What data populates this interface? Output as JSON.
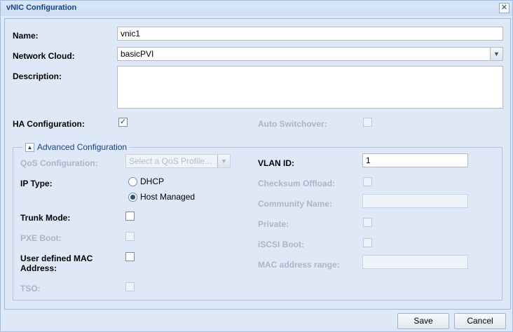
{
  "window": {
    "title": "vNIC Configuration",
    "close_glyph": "✕"
  },
  "fields": {
    "name_label": "Name:",
    "name_value": "vnic1",
    "network_cloud_label": "Network Cloud:",
    "network_cloud_value": "basicPVI",
    "description_label": "Description:",
    "description_value": "",
    "ha_config_label": "HA Configuration:",
    "ha_config_checked": true,
    "auto_switchover_label": "Auto Switchover:",
    "auto_switchover_checked": false
  },
  "advanced": {
    "legend": "Advanced Configuration",
    "toggle_glyph": "▲",
    "qos_label": "QoS Configuration:",
    "qos_placeholder": "Select a QoS Profile...",
    "vlan_label": "VLAN ID:",
    "vlan_value": "1",
    "ip_type_label": "IP Type:",
    "ip_type_options": [
      "DHCP",
      "Host Managed"
    ],
    "ip_type_selected": "Host Managed",
    "checksum_label": "Checksum Offload:",
    "community_label": "Community Name:",
    "community_value": "",
    "trunk_label": "Trunk Mode:",
    "private_label": "Private:",
    "pxe_label": "PXE Boot:",
    "iscsi_label": "iSCSI Boot:",
    "mac_label_line1": "User defined MAC",
    "mac_label_line2": "Address:",
    "mac_range_label": "MAC address range:",
    "mac_range_value": "",
    "tso_label": "TSO:"
  },
  "buttons": {
    "save": "Save",
    "cancel": "Cancel"
  },
  "colors": {
    "background": "#dfe8f6",
    "title_text": "#15428b",
    "disabled_text": "#aab5c5"
  }
}
